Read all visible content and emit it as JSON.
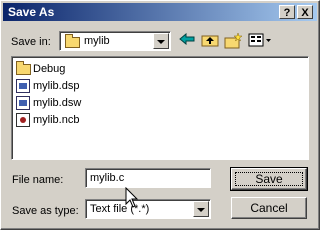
{
  "dialog": {
    "title": "Save As",
    "help_btn": "?",
    "close_btn": "X"
  },
  "save_in": {
    "label": "Save in:",
    "value": "mylib"
  },
  "toolbar": {
    "icons": [
      "back-icon",
      "up-folder-icon",
      "new-folder-icon",
      "view-menu-icon"
    ]
  },
  "files": [
    {
      "name": "Debug",
      "icon": "folder-icon"
    },
    {
      "name": "mylib.dsp",
      "icon": "project-file-icon"
    },
    {
      "name": "mylib.dsw",
      "icon": "workspace-file-icon"
    },
    {
      "name": "mylib.ncb",
      "icon": "ncb-file-icon"
    }
  ],
  "file_name": {
    "label": "File name:",
    "value": "mylib.c"
  },
  "save_as_type": {
    "label": "Save as type:",
    "value": "Text file (*.*)"
  },
  "buttons": {
    "save": "Save",
    "cancel": "Cancel"
  }
}
